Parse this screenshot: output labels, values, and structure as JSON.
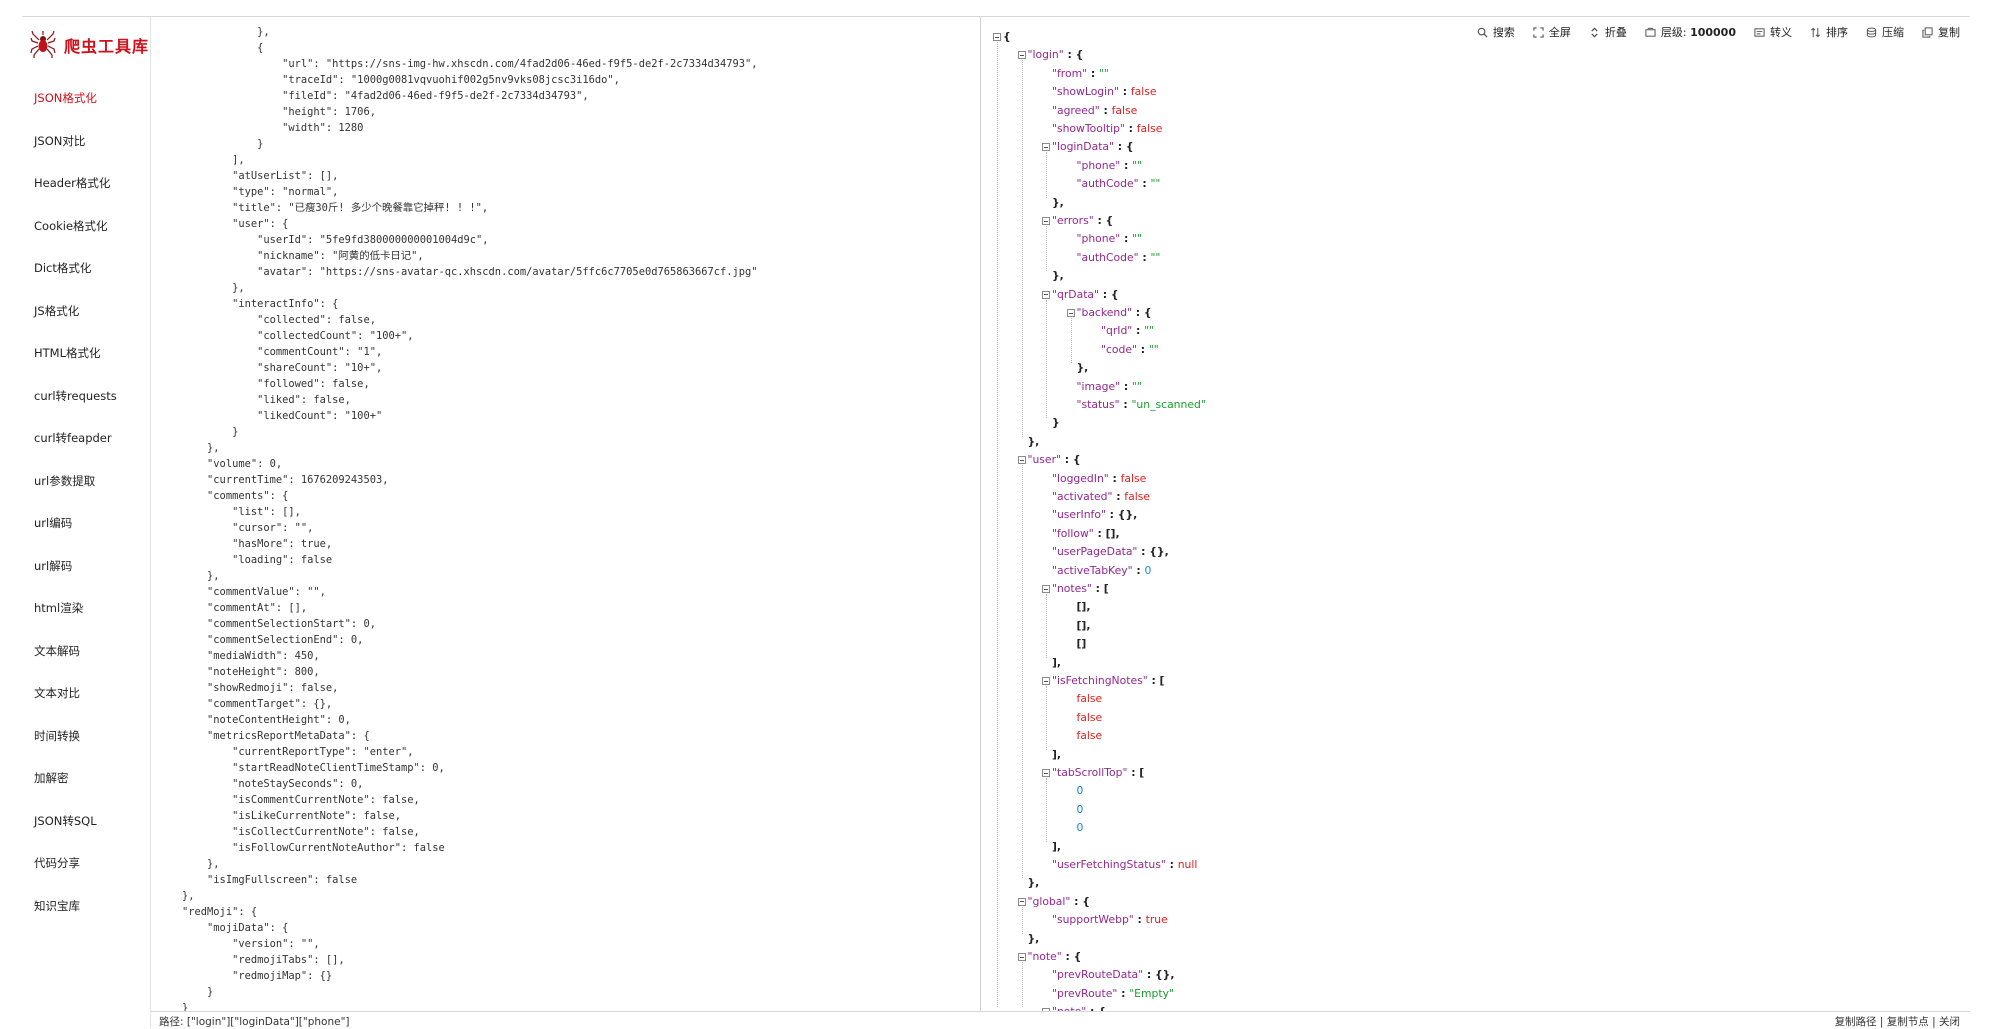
{
  "app": {
    "title": "爬虫工具库",
    "brand_color": "#d0101b"
  },
  "sidebar": {
    "items": [
      {
        "label": "JSON格式化",
        "active": true
      },
      {
        "label": "JSON对比"
      },
      {
        "label": "Header格式化"
      },
      {
        "label": "Cookie格式化"
      },
      {
        "label": "Dict格式化"
      },
      {
        "label": "JS格式化"
      },
      {
        "label": "HTML格式化"
      },
      {
        "label": "curl转requests"
      },
      {
        "label": "curl转feapder"
      },
      {
        "label": "url参数提取"
      },
      {
        "label": "url编码"
      },
      {
        "label": "url解码"
      },
      {
        "label": "html渲染"
      },
      {
        "label": "文本解码"
      },
      {
        "label": "文本对比"
      },
      {
        "label": "时间转换"
      },
      {
        "label": "加解密"
      },
      {
        "label": "JSON转SQL"
      },
      {
        "label": "代码分享"
      },
      {
        "label": "知识宝库"
      }
    ]
  },
  "code_lines": [
    "                },",
    "                {",
    "                    \"url\": \"https://sns-img-hw.xhscdn.com/4fad2d06-46ed-f9f5-de2f-2c7334d34793\",",
    "                    \"traceId\": \"1000g0081vqvuohif002g5nv9vks08jcsc3i16do\",",
    "                    \"fileId\": \"4fad2d06-46ed-f9f5-de2f-2c7334d34793\",",
    "                    \"height\": 1706,",
    "                    \"width\": 1280",
    "                }",
    "            ],",
    "            \"atUserList\": [],",
    "            \"type\": \"normal\",",
    "            \"title\": \"已瘦30斤! 多少个晚餐靠它掉秤! ! !\",",
    "            \"user\": {",
    "                \"userId\": \"5fe9fd380000000001004d9c\",",
    "                \"nickname\": \"阿黄的低卡日记\",",
    "                \"avatar\": \"https://sns-avatar-qc.xhscdn.com/avatar/5ffc6c7705e0d765863667cf.jpg\"",
    "            },",
    "            \"interactInfo\": {",
    "                \"collected\": false,",
    "                \"collectedCount\": \"100+\",",
    "                \"commentCount\": \"1\",",
    "                \"shareCount\": \"10+\",",
    "                \"followed\": false,",
    "                \"liked\": false,",
    "                \"likedCount\": \"100+\"",
    "            }",
    "        },",
    "        \"volume\": 0,",
    "        \"currentTime\": 1676209243503,",
    "        \"comments\": {",
    "            \"list\": [],",
    "            \"cursor\": \"\",",
    "            \"hasMore\": true,",
    "            \"loading\": false",
    "        },",
    "        \"commentValue\": \"\",",
    "        \"commentAt\": [],",
    "        \"commentSelectionStart\": 0,",
    "        \"commentSelectionEnd\": 0,",
    "        \"mediaWidth\": 450,",
    "        \"noteHeight\": 800,",
    "        \"showRedmoji\": false,",
    "        \"commentTarget\": {},",
    "        \"noteContentHeight\": 0,",
    "        \"metricsReportMetaData\": {",
    "            \"currentReportType\": \"enter\",",
    "            \"startReadNoteClientTimeStamp\": 0,",
    "            \"noteStaySeconds\": 0,",
    "            \"isCommentCurrentNote\": false,",
    "            \"isLikeCurrentNote\": false,",
    "            \"isCollectCurrentNote\": false,",
    "            \"isFollowCurrentNoteAuthor\": false",
    "        },",
    "        \"isImgFullscreen\": false",
    "    },",
    "    \"redMoji\": {",
    "        \"mojiData\": {",
    "            \"version\": \"\",",
    "            \"redmojiTabs\": [],",
    "            \"redmojiMap\": {}",
    "        }",
    "    }"
  ],
  "toolbar": {
    "search": "搜索",
    "fullscreen": "全屏",
    "collapse": "折叠",
    "level_label": "层级:",
    "level_value": "100000",
    "escape": "转义",
    "sort": "排序",
    "compress": "压缩",
    "copy": "复制"
  },
  "tree_lines": [
    [
      {
        "t": "{",
        "c": "p"
      }
    ],
    [
      {
        "t": "\"login\"",
        "c": "k"
      },
      {
        "t": " : {",
        "c": "p"
      }
    ],
    [
      {
        "t": "\"from\"",
        "c": "k"
      },
      {
        "t": " : ",
        "c": "p"
      },
      {
        "t": "\"\"",
        "c": "s"
      }
    ],
    [
      {
        "t": "\"showLogin\"",
        "c": "k"
      },
      {
        "t": " : ",
        "c": "p"
      },
      {
        "t": "false",
        "c": "b"
      }
    ],
    [
      {
        "t": "\"agreed\"",
        "c": "k"
      },
      {
        "t": " : ",
        "c": "p"
      },
      {
        "t": "false",
        "c": "b"
      }
    ],
    [
      {
        "t": "\"showTooltip\"",
        "c": "k"
      },
      {
        "t": " : ",
        "c": "p"
      },
      {
        "t": "false",
        "c": "b"
      }
    ],
    [
      {
        "t": "\"loginData\"",
        "c": "k"
      },
      {
        "t": " : {",
        "c": "p"
      }
    ],
    [
      {
        "t": "\"phone\"",
        "c": "k"
      },
      {
        "t": " : ",
        "c": "p"
      },
      {
        "t": "\"\"",
        "c": "s"
      }
    ],
    [
      {
        "t": "\"authCode\"",
        "c": "k"
      },
      {
        "t": " : ",
        "c": "p"
      },
      {
        "t": "\"\"",
        "c": "s"
      }
    ],
    [
      {
        "t": "},",
        "c": "p"
      }
    ],
    [
      {
        "t": "\"errors\"",
        "c": "k"
      },
      {
        "t": " : {",
        "c": "p"
      }
    ],
    [
      {
        "t": "\"phone\"",
        "c": "k"
      },
      {
        "t": " : ",
        "c": "p"
      },
      {
        "t": "\"\"",
        "c": "s"
      }
    ],
    [
      {
        "t": "\"authCode\"",
        "c": "k"
      },
      {
        "t": " : ",
        "c": "p"
      },
      {
        "t": "\"\"",
        "c": "s"
      }
    ],
    [
      {
        "t": "},",
        "c": "p"
      }
    ],
    [
      {
        "t": "\"qrData\"",
        "c": "k"
      },
      {
        "t": " : {",
        "c": "p"
      }
    ],
    [
      {
        "t": "\"backend\"",
        "c": "k"
      },
      {
        "t": " : {",
        "c": "p"
      }
    ],
    [
      {
        "t": "\"qrId\"",
        "c": "k"
      },
      {
        "t": " : ",
        "c": "p"
      },
      {
        "t": "\"\"",
        "c": "s"
      }
    ],
    [
      {
        "t": "\"code\"",
        "c": "k"
      },
      {
        "t": " : ",
        "c": "p"
      },
      {
        "t": "\"\"",
        "c": "s"
      }
    ],
    [
      {
        "t": "},",
        "c": "p"
      }
    ],
    [
      {
        "t": "\"image\"",
        "c": "k"
      },
      {
        "t": " : ",
        "c": "p"
      },
      {
        "t": "\"\"",
        "c": "s"
      }
    ],
    [
      {
        "t": "\"status\"",
        "c": "k"
      },
      {
        "t": " : ",
        "c": "p"
      },
      {
        "t": "\"un_scanned\"",
        "c": "s"
      }
    ],
    [
      {
        "t": "}",
        "c": "p"
      }
    ],
    [
      {
        "t": "},",
        "c": "p"
      }
    ],
    [
      {
        "t": "\"user\"",
        "c": "k"
      },
      {
        "t": " : {",
        "c": "p"
      }
    ],
    [
      {
        "t": "\"loggedIn\"",
        "c": "k"
      },
      {
        "t": " : ",
        "c": "p"
      },
      {
        "t": "false",
        "c": "b"
      }
    ],
    [
      {
        "t": "\"activated\"",
        "c": "k"
      },
      {
        "t": " : ",
        "c": "p"
      },
      {
        "t": "false",
        "c": "b"
      }
    ],
    [
      {
        "t": "\"userInfo\"",
        "c": "k"
      },
      {
        "t": " : {},",
        "c": "p"
      }
    ],
    [
      {
        "t": "\"follow\"",
        "c": "k"
      },
      {
        "t": " : [],",
        "c": "p"
      }
    ],
    [
      {
        "t": "\"userPageData\"",
        "c": "k"
      },
      {
        "t": " : {},",
        "c": "p"
      }
    ],
    [
      {
        "t": "\"activeTabKey\"",
        "c": "k"
      },
      {
        "t": " : ",
        "c": "p"
      },
      {
        "t": "0",
        "c": "n"
      }
    ],
    [
      {
        "t": "\"notes\"",
        "c": "k"
      },
      {
        "t": " : [",
        "c": "p"
      }
    ],
    [
      {
        "t": "[],",
        "c": "p"
      }
    ],
    [
      {
        "t": "[],",
        "c": "p"
      }
    ],
    [
      {
        "t": "[]",
        "c": "p"
      }
    ],
    [
      {
        "t": "],",
        "c": "p"
      }
    ],
    [
      {
        "t": "\"isFetchingNotes\"",
        "c": "k"
      },
      {
        "t": " : [",
        "c": "p"
      }
    ],
    [
      {
        "t": "false",
        "c": "b"
      }
    ],
    [
      {
        "t": "false",
        "c": "b"
      }
    ],
    [
      {
        "t": "false",
        "c": "b"
      }
    ],
    [
      {
        "t": "],",
        "c": "p"
      }
    ],
    [
      {
        "t": "\"tabScrollTop\"",
        "c": "k"
      },
      {
        "t": " : [",
        "c": "p"
      }
    ],
    [
      {
        "t": "0",
        "c": "n"
      }
    ],
    [
      {
        "t": "0",
        "c": "n"
      }
    ],
    [
      {
        "t": "0",
        "c": "n"
      }
    ],
    [
      {
        "t": "],",
        "c": "p"
      }
    ],
    [
      {
        "t": "\"userFetchingStatus\"",
        "c": "k"
      },
      {
        "t": " : ",
        "c": "p"
      },
      {
        "t": "null",
        "c": "nu"
      }
    ],
    [
      {
        "t": "},",
        "c": "p"
      }
    ],
    [
      {
        "t": "\"global\"",
        "c": "k"
      },
      {
        "t": " : {",
        "c": "p"
      }
    ],
    [
      {
        "t": "\"supportWebp\"",
        "c": "k"
      },
      {
        "t": " : ",
        "c": "p"
      },
      {
        "t": "true",
        "c": "b"
      }
    ],
    [
      {
        "t": "},",
        "c": "p"
      }
    ],
    [
      {
        "t": "\"note\"",
        "c": "k"
      },
      {
        "t": " : {",
        "c": "p"
      }
    ],
    [
      {
        "t": "\"prevRouteData\"",
        "c": "k"
      },
      {
        "t": " : {},",
        "c": "p"
      }
    ],
    [
      {
        "t": "\"prevRoute\"",
        "c": "k"
      },
      {
        "t": " : ",
        "c": "p"
      },
      {
        "t": "\"Empty\"",
        "c": "s"
      }
    ],
    [
      {
        "t": "\"note\"",
        "c": "k"
      },
      {
        "t": " : {",
        "c": "p"
      }
    ]
  ],
  "status": {
    "path": "路径: [\"login\"][\"loginData\"][\"phone\"]",
    "copy_path": "复制路径",
    "copy_node": "复制节点",
    "close": "关闭",
    "sep": " | "
  }
}
